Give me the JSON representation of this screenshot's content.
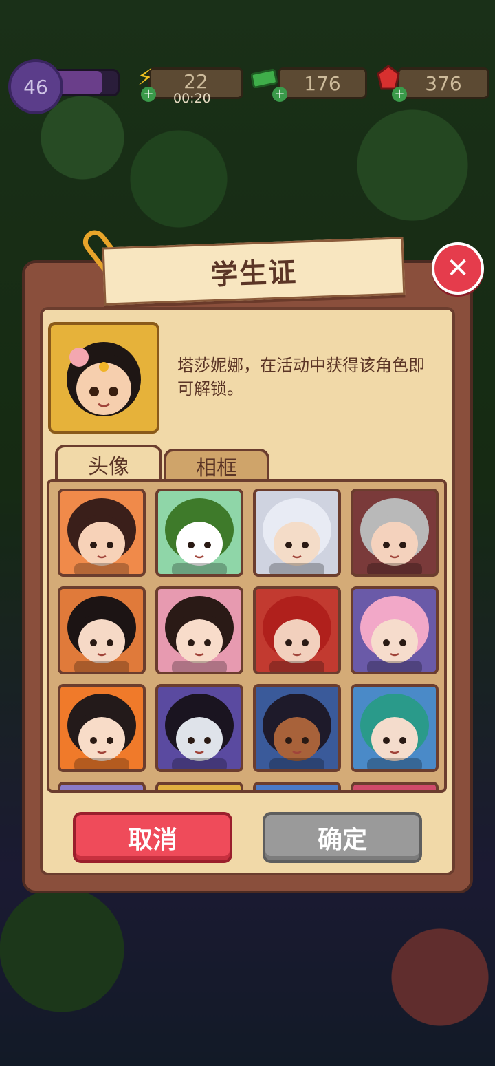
{
  "hud": {
    "level": "46",
    "xp_fraction": 0.78,
    "energy": "22",
    "energy_timer": "00:20",
    "cash": "176",
    "gems": "376",
    "icons": [
      "lightning-icon",
      "cash-icon",
      "ruby-icon",
      "plus-icon"
    ]
  },
  "dialog": {
    "title": "学生证",
    "description": "塔莎妮娜，在活动中获得该角色即可解锁。",
    "tabs": [
      {
        "label": "头像",
        "active": true
      },
      {
        "label": "相框",
        "active": false
      }
    ],
    "cancel_label": "取消",
    "confirm_label": "确定",
    "close_icon": "close-icon"
  },
  "colors": {
    "accent_red": "#ef4b5a",
    "disabled_gray": "#9a9a9a",
    "panel": "#f1d9a8",
    "frame": "#8a4f3c"
  },
  "avatars": [
    {
      "bg": "#f08a4a",
      "hair": "#3a1f1a",
      "skin": "#f7d2b8"
    },
    {
      "bg": "#8fd6a8",
      "hair": "#3e7a2a",
      "skin": "#ffffff"
    },
    {
      "bg": "#cfd3e0",
      "hair": "#e8ebf4",
      "skin": "#f4dcc8"
    },
    {
      "bg": "#7a3a3a",
      "hair": "#b9b9b9",
      "skin": "#f4d2bd"
    },
    {
      "bg": "#e07a3a",
      "hair": "#1c1414",
      "skin": "#f6d9c6"
    },
    {
      "bg": "#e79ab0",
      "hair": "#2a1a16",
      "skin": "#f8dcca"
    },
    {
      "bg": "#c23a30",
      "hair": "#b0201c",
      "skin": "#f2d0bd"
    },
    {
      "bg": "#6a5aa8",
      "hair": "#f2a8c8",
      "skin": "#f6dccc"
    },
    {
      "bg": "#f07a2a",
      "hair": "#231a1a",
      "skin": "#f8dcc8"
    },
    {
      "bg": "#5a4aa0",
      "hair": "#1a1420",
      "skin": "#dfe3ea"
    },
    {
      "bg": "#3a5a9a",
      "hair": "#1e1a2a",
      "skin": "#a8623a"
    },
    {
      "bg": "#4a8ac8",
      "hair": "#2a9a8a",
      "skin": "#f4dccc"
    }
  ]
}
